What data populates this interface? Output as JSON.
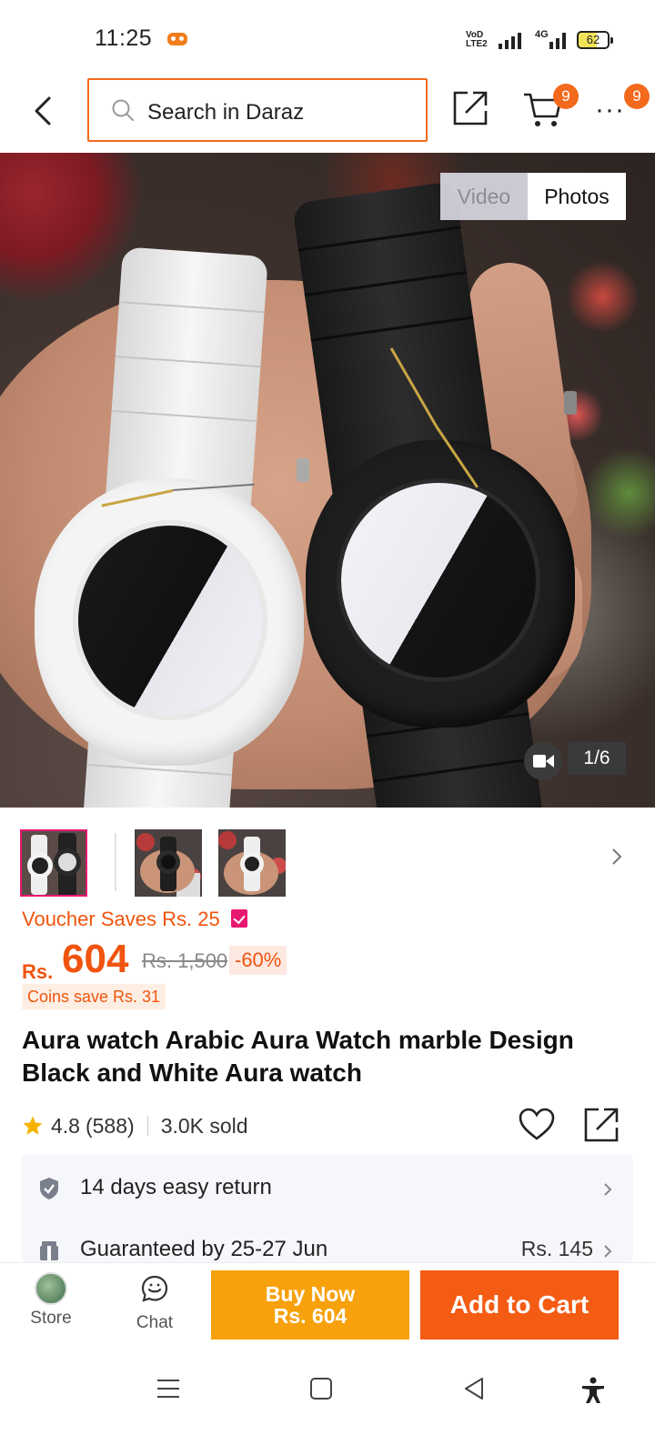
{
  "status_bar": {
    "time": "11:25",
    "volte": "VoD LTE2",
    "network": "4G",
    "battery": "62"
  },
  "nav": {
    "search_placeholder": "Search in Daraz",
    "cart_count": "9",
    "more_count": "9"
  },
  "gallery": {
    "video_tab": "Video",
    "photos_tab": "Photos",
    "counter": "1/6"
  },
  "price": {
    "voucher": "Voucher Saves Rs. 25",
    "currency": "Rs.",
    "current": "604",
    "original": "Rs. 1,500",
    "discount": "-60%",
    "coins": "Coins save Rs. 31"
  },
  "product": {
    "title": "Aura watch Arabic Aura Watch marble Design Black and White Aura watch",
    "rating": "4.8",
    "reviews": "(588)",
    "sold": "3.0K sold"
  },
  "info": {
    "return": "14 days easy return",
    "delivery": "Guaranteed by 25-27 Jun",
    "delivery_fee": "Rs. 145"
  },
  "actions": {
    "store": "Store",
    "chat": "Chat",
    "buy_now_line1": "Buy Now",
    "buy_now_line2": "Rs. 604",
    "add_to_cart": "Add to Cart"
  },
  "colors": {
    "accent": "#f36a1d",
    "buy_now": "#f7a10c",
    "add_to_cart": "#f45b13",
    "voucher": "#e8176f"
  }
}
